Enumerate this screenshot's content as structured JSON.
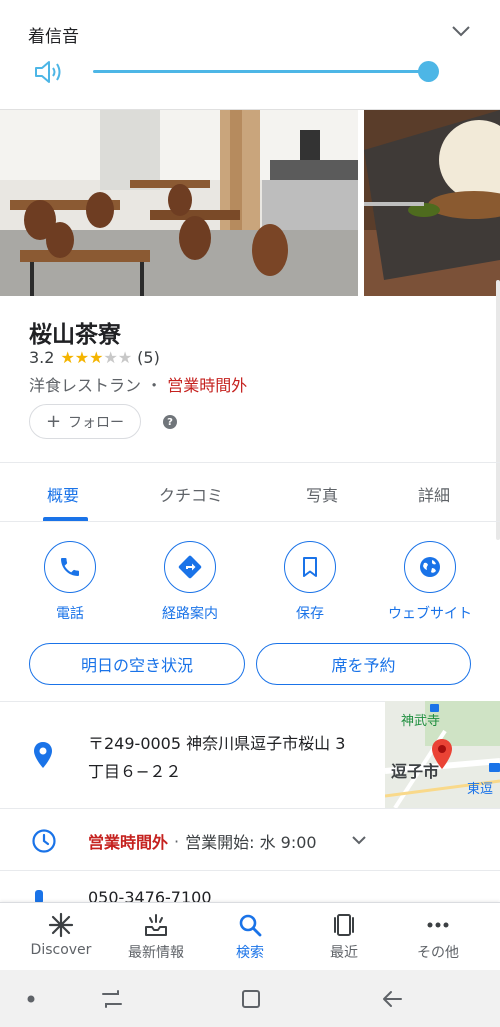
{
  "volume": {
    "title": "着信音",
    "level": 1.0,
    "accent": "#4db6e6",
    "icons": [
      "speaker-icon",
      "chevron-down-icon"
    ]
  },
  "place": {
    "name": "桜山茶寮",
    "rating": "3.2",
    "stars": 3,
    "stars_max": 5,
    "review_count": "(5)",
    "category": "洋食レストラン",
    "separator": "・",
    "status": "営業時間外",
    "follow_label": "フォロー",
    "help_icon_text": "?"
  },
  "tabs": [
    {
      "label": "概要",
      "active": true
    },
    {
      "label": "クチコミ",
      "active": false
    },
    {
      "label": "写真",
      "active": false
    },
    {
      "label": "詳細",
      "active": false
    }
  ],
  "actions": [
    {
      "label": "電話",
      "icon": "phone-icon"
    },
    {
      "label": "経路案内",
      "icon": "directions-icon"
    },
    {
      "label": "保存",
      "icon": "bookmark-icon"
    },
    {
      "label": "ウェブサイト",
      "icon": "globe-icon"
    }
  ],
  "pills": {
    "availability": "明日の空き状況",
    "reserve": "席を予約"
  },
  "address": {
    "line1": "〒249-0005 神奈川県逗子市桜山 3",
    "line2": "丁目６−２２"
  },
  "map": {
    "labels": [
      "神武寺",
      "逗子市",
      "東逗"
    ],
    "pin_color": "#ea4335"
  },
  "hours": {
    "status": "営業時間外",
    "separator": "·",
    "opens": "営業開始: 水 9:00"
  },
  "phone_peek": "050-3476-7100",
  "bottom_nav": [
    {
      "label": "Discover",
      "icon": "asterisk-icon",
      "active": false
    },
    {
      "label": "最新情報",
      "icon": "updates-icon",
      "active": false
    },
    {
      "label": "検索",
      "icon": "search-icon",
      "active": true
    },
    {
      "label": "最近",
      "icon": "recent-icon",
      "active": false
    },
    {
      "label": "その他",
      "icon": "more-icon",
      "active": false
    }
  ],
  "colors": {
    "primary": "#1a73e8",
    "closed": "#c5221f",
    "star": "#f4b400"
  }
}
